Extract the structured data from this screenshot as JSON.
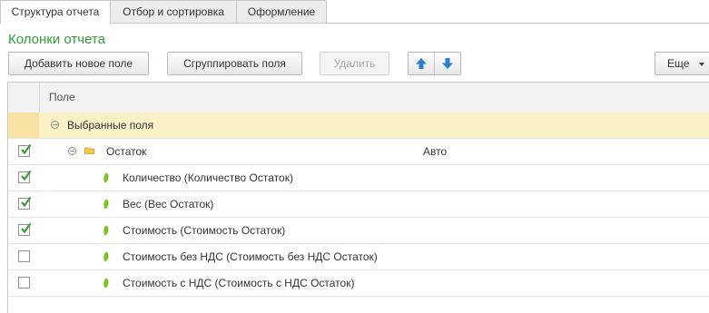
{
  "tabs": [
    {
      "label": "Структура отчета",
      "active": true
    },
    {
      "label": "Отбор и сортировка",
      "active": false
    },
    {
      "label": "Оформление",
      "active": false
    }
  ],
  "section_title": "Колонки отчета",
  "toolbar": {
    "add_field": "Добавить новое поле",
    "group_fields": "Сгруппировать поля",
    "delete": "Удалить",
    "more": "Еще",
    "move_up_icon": "arrow-up-icon",
    "move_down_icon": "arrow-down-icon"
  },
  "table": {
    "header": "Поле",
    "group_row": {
      "label": "Выбранные поля",
      "expanded": true
    },
    "folder_row": {
      "label": "Остаток",
      "value": "Авто",
      "checked": true,
      "expanded": true
    },
    "fields": [
      {
        "label": "Количество (Количество Остаток)",
        "checked": true
      },
      {
        "label": "Вес (Вес Остаток)",
        "checked": true
      },
      {
        "label": "Стоимость (Стоимость Остаток)",
        "checked": true
      },
      {
        "label": "Стоимость без НДС (Стоимость без НДС Остаток)",
        "checked": false
      },
      {
        "label": "Стоимость с НДС (Стоимость с НДС Остаток)",
        "checked": false
      }
    ]
  },
  "colors": {
    "accent_green": "#2f9d3a",
    "group_row_bg": "#fbf1c7",
    "arrow_blue": "#2f7fd0",
    "checkmark_green": "#3f9a3f",
    "field_icon_green": "#7cc424"
  }
}
